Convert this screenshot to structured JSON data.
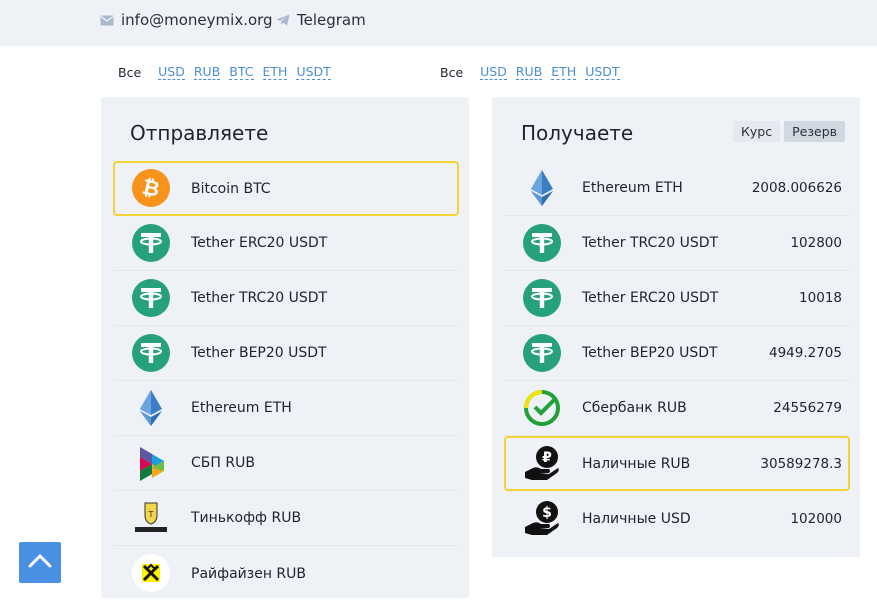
{
  "header": {
    "email": "info@moneymix.org",
    "telegram": "Telegram"
  },
  "filters_send": {
    "all": "Все",
    "items": [
      "USD",
      "RUB",
      "BTC",
      "ETH",
      "USDT"
    ]
  },
  "filters_receive": {
    "all": "Все",
    "items": [
      "USD",
      "RUB",
      "ETH",
      "USDT"
    ]
  },
  "send": {
    "title": "Отправляете",
    "items": [
      {
        "label": "Bitcoin BTC",
        "icon": "bitcoin-icon",
        "selected": true
      },
      {
        "label": "Tether ERC20 USDT",
        "icon": "tether-icon"
      },
      {
        "label": "Tether TRC20 USDT",
        "icon": "tether-icon"
      },
      {
        "label": "Tether BEP20 USDT",
        "icon": "tether-icon"
      },
      {
        "label": "Ethereum ETH",
        "icon": "ethereum-icon"
      },
      {
        "label": "СБП RUB",
        "icon": "sbp-icon"
      },
      {
        "label": "Тинькофф RUB",
        "icon": "tinkoff-icon"
      },
      {
        "label": "Райфайзен RUB",
        "icon": "raiffeisen-icon"
      }
    ]
  },
  "receive": {
    "title": "Получаете",
    "tabs": {
      "rate": "Курс",
      "reserve": "Резерв"
    },
    "items": [
      {
        "label": "Ethereum ETH",
        "icon": "ethereum-icon",
        "reserve": "2008.006626"
      },
      {
        "label": "Tether TRC20 USDT",
        "icon": "tether-icon",
        "reserve": "102800"
      },
      {
        "label": "Tether ERC20 USDT",
        "icon": "tether-icon",
        "reserve": "10018"
      },
      {
        "label": "Tether BEP20 USDT",
        "icon": "tether-icon",
        "reserve": "4949.2705"
      },
      {
        "label": "Сбербанк RUB",
        "icon": "sberbank-icon",
        "reserve": "24556279"
      },
      {
        "label": "Наличные RUB",
        "icon": "cash-rub-icon",
        "reserve": "30589278.3",
        "selected": true
      },
      {
        "label": "Наличные USD",
        "icon": "cash-usd-icon",
        "reserve": "102000"
      }
    ]
  },
  "colors": {
    "accent_link": "#4a8fd6",
    "selected_border": "#f2d234",
    "panel_bg": "#eef1f6",
    "tether": "#26a17b",
    "bitcoin": "#f7931a",
    "scroll_top_button": "#4a90e2"
  }
}
